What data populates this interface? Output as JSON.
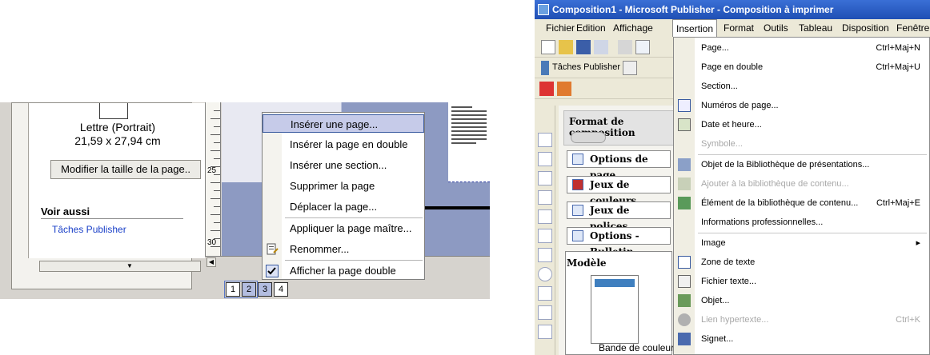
{
  "left_panel": {
    "page_size_name": "Lettre (Portrait)",
    "page_size_dims": "21,59 x 27,94 cm",
    "resize_button": "Modifier la taille de la page..",
    "see_also_heading": "Voir aussi",
    "publisher_tasks_link": "Tâches Publisher",
    "ruler_numbers": [
      "25",
      "30"
    ],
    "page_tabs": [
      "1",
      "2",
      "3",
      "4"
    ],
    "context_menu": [
      {
        "label": "Insérer une page...",
        "highlight": true,
        "icon": ""
      },
      {
        "label": "Insérer la page en double",
        "icon": ""
      },
      {
        "label": "Insérer une section...",
        "icon": ""
      },
      {
        "label": "Supprimer la page",
        "icon": ""
      },
      {
        "label": "Déplacer la page...",
        "icon": ""
      },
      {
        "label": "Appliquer la page maître...",
        "icon": ""
      },
      {
        "label": "Renommer...",
        "icon": "rename-icon"
      },
      {
        "label": "Afficher la page double",
        "icon": "checkmark-icon"
      }
    ]
  },
  "right_panel": {
    "window_title": "Composition1 - Microsoft Publisher - Composition à imprimer",
    "menubar": [
      "Fichier",
      "Edition",
      "Affichage",
      "Insertion",
      "Format",
      "Outils",
      "Tableau",
      "Disposition",
      "Fenêtre"
    ],
    "open_menu": "Insertion",
    "toolbar_tasks_label": "Tâches Publisher",
    "taskpane_title": "Format de composition",
    "taskpane_buttons": [
      "Options de page",
      "Jeux de couleurs",
      "Jeux de polices",
      "Options - Bulletin"
    ],
    "taskpane_model_heading": "Modèle",
    "model_caption": "Bande de couleurs",
    "insertion_menu": [
      {
        "label": "Page...",
        "shortcut": "Ctrl+Maj+N",
        "disabled": false,
        "icon": ""
      },
      {
        "label": "Page en double",
        "shortcut": "Ctrl+Maj+U",
        "disabled": false,
        "icon": ""
      },
      {
        "label": "Section...",
        "shortcut": "",
        "disabled": false,
        "icon": ""
      },
      {
        "label": "Numéros de page...",
        "shortcut": "",
        "disabled": false,
        "icon": "page-number-icon"
      },
      {
        "label": "Date et heure...",
        "shortcut": "",
        "disabled": false,
        "icon": "date-time-icon"
      },
      {
        "label": "Symbole...",
        "shortcut": "",
        "disabled": true,
        "icon": ""
      },
      {
        "label": "Objet de la Bibliothèque de présentations...",
        "shortcut": "",
        "disabled": false,
        "icon": "library-object-icon"
      },
      {
        "label": "Ajouter à la bibliothèque de contenu...",
        "shortcut": "",
        "disabled": true,
        "icon": "add-library-icon"
      },
      {
        "label": "Élément de la bibliothèque de contenu...",
        "shortcut": "Ctrl+Maj+E",
        "disabled": false,
        "icon": "library-element-icon"
      },
      {
        "label": "Informations professionnelles...",
        "shortcut": "",
        "disabled": false,
        "icon": ""
      },
      {
        "label": "Image",
        "shortcut": "▸",
        "disabled": false,
        "icon": ""
      },
      {
        "label": "Zone de texte",
        "shortcut": "",
        "disabled": false,
        "icon": "text-box-icon"
      },
      {
        "label": "Fichier texte...",
        "shortcut": "",
        "disabled": false,
        "icon": "text-file-icon"
      },
      {
        "label": "Objet...",
        "shortcut": "",
        "disabled": false,
        "icon": "object-icon"
      },
      {
        "label": "Lien hypertexte...",
        "shortcut": "Ctrl+K",
        "disabled": true,
        "icon": "hyperlink-icon"
      },
      {
        "label": "Signet...",
        "shortcut": "",
        "disabled": false,
        "icon": "bookmark-icon"
      }
    ]
  }
}
